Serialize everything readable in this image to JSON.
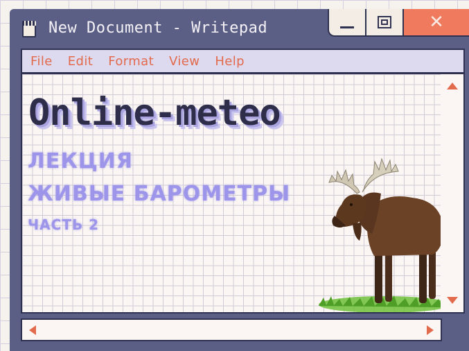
{
  "window": {
    "title": "New Document - Writepad",
    "close_glyph": "✕"
  },
  "menu": {
    "items": [
      "File",
      "Edit",
      "Format",
      "View",
      "Help"
    ]
  },
  "document": {
    "headline": "Online-meteo",
    "line1": "ЛЕКЦИЯ",
    "line2": "ЖИВЫЕ БАРОМЕТРЫ",
    "line3": "ЧАСТЬ 2"
  },
  "icons": {
    "document": "document-icon",
    "minimize": "minimize-icon",
    "maximize": "maximize-icon",
    "close": "close-icon",
    "moose": "moose-illustration",
    "scroll_up": "arrow-up-icon",
    "scroll_down": "arrow-down-icon",
    "scroll_left": "arrow-left-icon",
    "scroll_right": "arrow-right-icon"
  },
  "colors": {
    "window_frame": "#5b5f86",
    "menu_text": "#e26a4d",
    "close_button": "#ef7a5d",
    "headline": "#2e2e4a",
    "subtitle": "#9d95ea"
  }
}
